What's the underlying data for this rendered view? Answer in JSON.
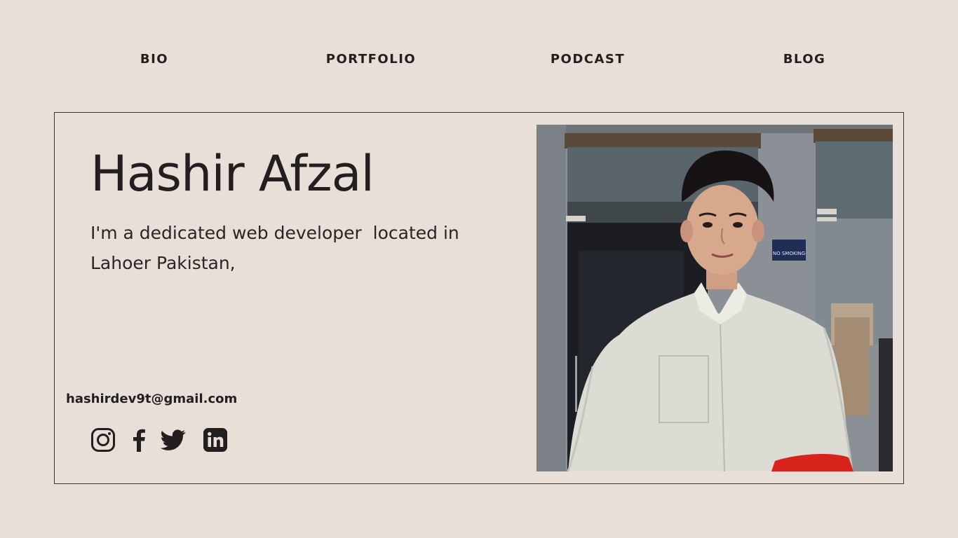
{
  "nav": {
    "items": [
      {
        "label": "BIO"
      },
      {
        "label": "PORTFOLIO"
      },
      {
        "label": "PODCAST"
      },
      {
        "label": "BLOG"
      }
    ]
  },
  "profile": {
    "name": "Hashir Afzal",
    "bio": "I'm a dedicated web developer  located in\nLahoer Pakistan,",
    "email": "hashirdev9t@gmail.com"
  },
  "socials": [
    {
      "icon": "instagram-icon"
    },
    {
      "icon": "facebook-icon"
    },
    {
      "icon": "twitter-icon"
    },
    {
      "icon": "linkedin-icon"
    }
  ],
  "photo": {
    "sign_text": "NO SMOKING"
  },
  "colors": {
    "background": "#e8dfd9",
    "text": "#231f1e",
    "border": "#3a3433"
  }
}
